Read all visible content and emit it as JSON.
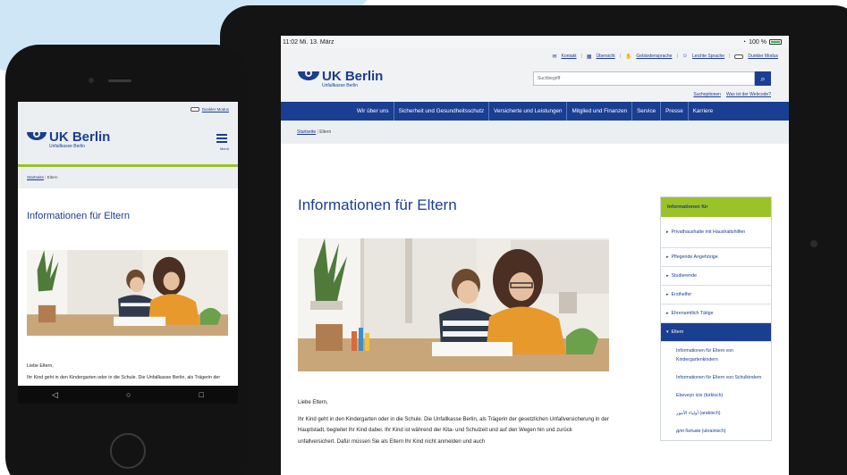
{
  "tablet": {
    "status": {
      "time_date": "11:02  Mi. 13. März",
      "battery": "100 %"
    },
    "utility_links": [
      "Kontakt",
      "Übersicht",
      "Gebärdensprache",
      "Leichte Sprache",
      "Dunkler Modus"
    ],
    "logo": {
      "title": "UK Berlin",
      "subtitle": "Unfallkasse Berlin"
    },
    "search": {
      "placeholder": "Suchbegriff",
      "links": [
        "Suchoptionen",
        "Was ist der Webcode?"
      ]
    },
    "nav": [
      "Wir über uns",
      "Sicherheit und Gesundheitsschutz",
      "Versicherte und Leistungen",
      "Mitglied und Finanzen",
      "Service",
      "Presse",
      "Karriere"
    ],
    "breadcrumb": {
      "home": "Startseite",
      "current": "Eltern"
    },
    "page_title": "Informationen für Eltern",
    "body": {
      "greeting": "Liebe Eltern,",
      "text": "Ihr Kind geht in den Kindergarten oder in die Schule. Die Unfallkasse Berlin, als Trägerin der gesetzlichen Unfallversicherung in der Hauptstadt, begleitet Ihr Kind dabei. Ihr Kind ist während der Kita- und Schulzeit und auf den Wegen hin und zurück unfallversichert. Dafür müssen Sie als Eltern Ihr Kind nicht anmelden und auch"
    },
    "sidebar": {
      "heading": "Informationen für",
      "items": [
        "Privathaushalte mit Haushaltshilfen",
        "Pflegende Angehörige",
        "Studierende",
        "Ersthelfer",
        "Ehrenamtlich Tätige",
        "Eltern"
      ],
      "subitems": [
        "Informationen für Eltern von Kindergartenkindern",
        "Informationen für Eltern von Schulkindern",
        "Ebeveyn icin (türkisch)",
        "أولياء الأمور (arabisch)",
        "для батьків (ukrainisch)"
      ]
    }
  },
  "phone": {
    "dark_mode": "Dunkler Modus",
    "logo": {
      "title": "UK Berlin",
      "subtitle": "Unfallkasse Berlin"
    },
    "menu_label": "Menü",
    "breadcrumb": {
      "home": "Startseite",
      "current": "Eltern"
    },
    "page_title": "Informationen für Eltern",
    "body": {
      "greeting": "Liebe Eltern,",
      "text": "Ihr Kind geht in den Kindergarten oder in die Schule. Die Unfallkasse Berlin, als Trägerin der gesetzlichen Unfallversicherung in der Hauptstadt, begleitet Ihr Kind dabei. Ihr Kind ist während der Kita- und Schulzeit und auf den"
    },
    "nav_buttons": [
      "◁",
      "○",
      "□"
    ]
  },
  "colors": {
    "brand_blue": "#1a3e91",
    "accent_green": "#9bc328",
    "background_blue": "#cfe6f7"
  },
  "icons": [
    "wifi-icon",
    "battery-icon",
    "contact-icon",
    "sitemap-icon",
    "sign-language-icon",
    "easy-language-icon",
    "search-icon",
    "hamburger-menu-icon",
    "back-icon",
    "home-icon",
    "recent-apps-icon"
  ]
}
